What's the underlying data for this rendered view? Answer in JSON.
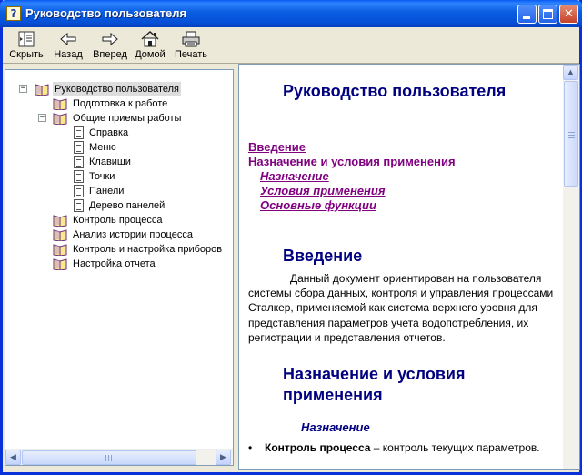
{
  "window": {
    "title": "Руководство пользователя",
    "icon": "help-book-icon"
  },
  "toolbar": {
    "hide_label": "Скрыть",
    "back_label": "Назад",
    "forward_label": "Вперед",
    "home_label": "Домой",
    "print_label": "Печать"
  },
  "tree": {
    "items": [
      {
        "label": "Руководство пользователя",
        "type": "book",
        "expander": "−"
      },
      {
        "label": "Подготовка к работе",
        "type": "book"
      },
      {
        "label": "Общие приемы работы",
        "type": "book",
        "expander": "−"
      },
      {
        "label": "Справка",
        "type": "page"
      },
      {
        "label": "Меню",
        "type": "page"
      },
      {
        "label": "Клавиши",
        "type": "page"
      },
      {
        "label": "Точки",
        "type": "page"
      },
      {
        "label": "Панели",
        "type": "page"
      },
      {
        "label": "Дерево панелей",
        "type": "page"
      },
      {
        "label": "Контроль процесса",
        "type": "book"
      },
      {
        "label": "Анализ истории процесса",
        "type": "book"
      },
      {
        "label": "Контроль  и настройка приборов",
        "type": "book"
      },
      {
        "label": "Настройка отчета",
        "type": "book"
      }
    ]
  },
  "document": {
    "title": "Руководство пользователя",
    "toc": [
      "Введение",
      "Назначение и условия  применения",
      "Назначение",
      "Условия применения",
      "Основные функции"
    ],
    "intro_heading": "Введение",
    "intro_text": "Данный документ ориентирован на пользователя системы сбора данных, контроля и управления процессами Сталкер, применяемой как система верхнего уровня для представления параметров учета водопотребления, их регистрации и представления отчетов.",
    "purpose_heading_line1": "Назначение и условия",
    "purpose_heading_line2": "применения",
    "subheading": "Назначение",
    "bullet_term": "Контроль процесса",
    "bullet_text": " – контроль текущих параметров."
  },
  "colors": {
    "titlebar": "#0a5ce0",
    "heading": "#000080",
    "link": "#800080"
  }
}
